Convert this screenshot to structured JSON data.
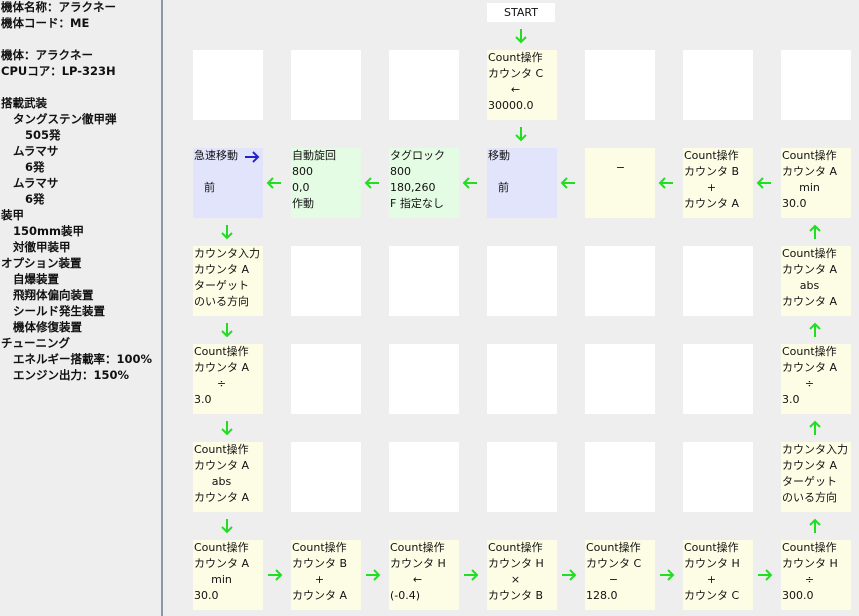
{
  "sidebar": {
    "lines": [
      "機体名称：アラクネー",
      "機体コード：ME",
      "機体：アラクネー",
      "CPUコア：LP-323H",
      "搭載武装",
      "タングステン徹甲弾",
      "505発",
      "ムラマサ",
      "6発",
      "ムラマサ",
      "6発",
      "装甲",
      "150mm装甲",
      "対徹甲装甲",
      "オプション装置",
      "自爆装置",
      "飛翔体偏向装置",
      "シールド発生装置",
      "機体修復装置",
      "チューニング",
      "エネルギー搭載率：100%",
      "エンジン出力：150%"
    ]
  },
  "flow": {
    "start": "START",
    "row0": {
      "c3": [
        "Count操作",
        "カウンタ C",
        "←",
        "30000.0"
      ]
    },
    "row1": {
      "c0": [
        "急速移動",
        "",
        "前"
      ],
      "c1": [
        "自動旋回",
        "800",
        "0,0",
        "作動"
      ],
      "c2": [
        "タグロック",
        "800",
        "180,260",
        "F 指定なし"
      ],
      "c3": [
        "移動",
        "",
        "前"
      ],
      "c4": [
        "−"
      ],
      "c5": [
        "Count操作",
        "カウンタ B",
        "+",
        "カウンタ A"
      ],
      "c6": [
        "Count操作",
        "カウンタ A",
        "min",
        "30.0"
      ]
    },
    "row2": {
      "c0": [
        "カウンタ入力",
        "カウンタ A",
        "ターゲット",
        "のいる方向"
      ],
      "c6": [
        "Count操作",
        "カウンタ A",
        "abs",
        "カウンタ A"
      ]
    },
    "row3": {
      "c0": [
        "Count操作",
        "カウンタ A",
        "÷",
        "3.0"
      ],
      "c6": [
        "Count操作",
        "カウンタ A",
        "÷",
        "3.0"
      ]
    },
    "row4": {
      "c0": [
        "Count操作",
        "カウンタ A",
        "abs",
        "カウンタ A"
      ],
      "c6": [
        "カウンタ入力",
        "カウンタ A",
        "ターゲット",
        "のいる方向"
      ]
    },
    "row5": {
      "c0": [
        "Count操作",
        "カウンタ A",
        "min",
        "30.0"
      ],
      "c1": [
        "Count操作",
        "カウンタ B",
        "+",
        "カウンタ A"
      ],
      "c2": [
        "Count操作",
        "カウンタ H",
        "←",
        "(-0.4)"
      ],
      "c3": [
        "Count操作",
        "カウンタ H",
        "×",
        "カウンタ B"
      ],
      "c4": [
        "Count操作",
        "カウンタ C",
        "−",
        "128.0"
      ],
      "c5": [
        "Count操作",
        "カウンタ H",
        "+",
        "カウンタ C"
      ],
      "c6": [
        "Count操作",
        "カウンタ H",
        "÷",
        "300.0"
      ]
    }
  },
  "colors": {
    "arrow_green": "#22dd22",
    "arrow_blue": "#2222cc",
    "chip_yellow": "#fdfde6",
    "chip_blue": "#e2e4fb",
    "chip_green": "#e4fbe4"
  }
}
